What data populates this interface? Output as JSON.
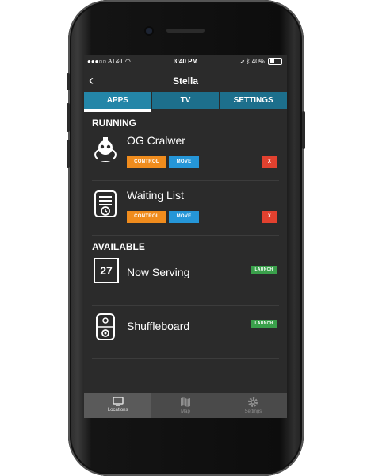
{
  "status_bar": {
    "carrier": "AT&T",
    "time": "3:40 PM",
    "battery": "40%",
    "battery_level": 0.4
  },
  "nav": {
    "title": "Stella"
  },
  "tabs": [
    {
      "label": "APPS",
      "active": true
    },
    {
      "label": "TV",
      "active": false
    },
    {
      "label": "SETTINGS",
      "active": false
    }
  ],
  "running": {
    "heading": "RUNNING",
    "items": [
      {
        "name": "OG Cralwer",
        "icon": "robot-icon",
        "control": "CONTROL",
        "move": "MOVE",
        "close": "X"
      },
      {
        "name": "Waiting List",
        "icon": "clipboard-clock-icon",
        "control": "CONTROL",
        "move": "MOVE",
        "close": "X"
      }
    ]
  },
  "available": {
    "heading": "AVAILABLE",
    "items": [
      {
        "name": "Now Serving",
        "icon_text": "27",
        "launch": "LAUNCH"
      },
      {
        "name": "Shuffleboard",
        "icon": "shuffleboard-icon",
        "launch": "LAUNCH"
      }
    ]
  },
  "footer": [
    {
      "label": "Locations",
      "icon": "tv-icon",
      "active": true
    },
    {
      "label": "Map",
      "icon": "map-icon",
      "active": false
    },
    {
      "label": "Settings",
      "icon": "gear-icon",
      "active": false
    }
  ],
  "colors": {
    "tab_bar": "#1d6f8c",
    "control": "#f08c1d",
    "move": "#2596d8",
    "close": "#e2412f",
    "launch": "#3aa04b"
  }
}
